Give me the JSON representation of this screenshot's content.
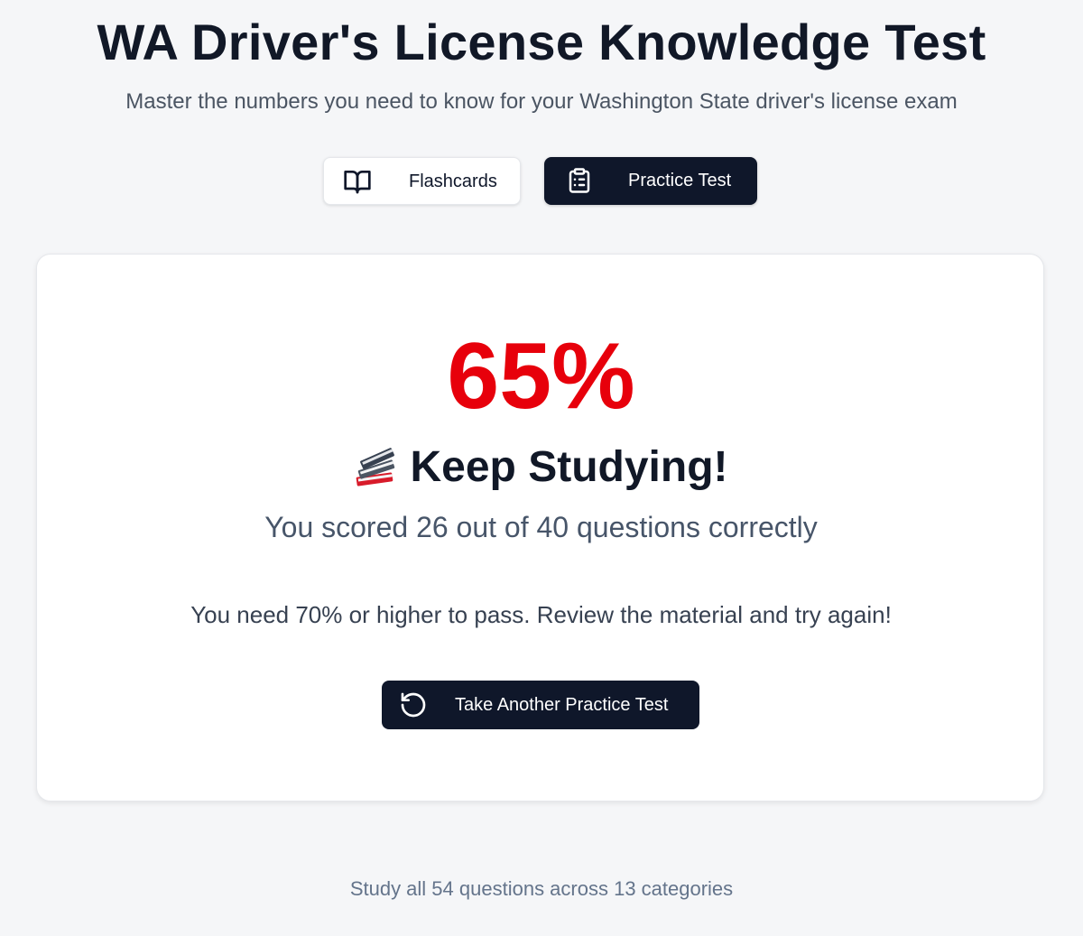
{
  "header": {
    "title": "WA Driver's License Knowledge Test",
    "subtitle": "Master the numbers you need to know for your Washington State driver's license exam"
  },
  "tabs": [
    {
      "label": "Flashcards",
      "icon": "book-open-icon",
      "active": false
    },
    {
      "label": "Practice Test",
      "icon": "clipboard-list-icon",
      "active": true
    }
  ],
  "result": {
    "score_percent": "65%",
    "status_icon": "books-icon",
    "status_heading": "Keep Studying!",
    "summary": "You scored 26 out of 40 questions correctly",
    "message": "You need 70% or higher to pass. Review the material and try again!",
    "retake_label": "Take Another Practice Test",
    "retake_icon": "rotate-ccw-icon"
  },
  "footer": {
    "note": "Study all 54 questions across 13 categories"
  },
  "colors": {
    "score_fail": "#e7000b",
    "primary_dark": "#0f172a",
    "background": "#f5f6f8"
  }
}
